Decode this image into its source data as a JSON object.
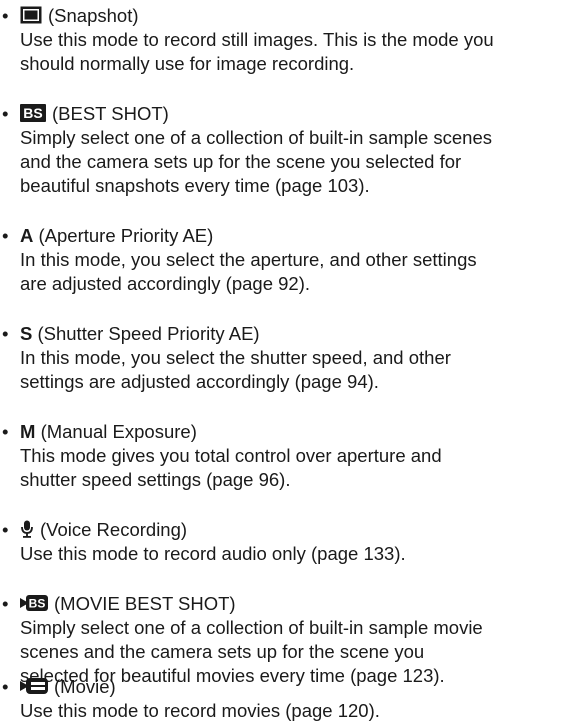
{
  "bullet": "•",
  "entries": [
    {
      "icon": "snapshot-icon",
      "name": "(Snapshot)",
      "lines": [
        "Use this mode to record still images. This is the mode you",
        "should normally use for image recording."
      ]
    },
    {
      "icon": "best-shot-icon",
      "icon_text": "BS",
      "name": "(BEST SHOT)",
      "lines": [
        "Simply select one of a collection of built-in sample scenes",
        "and the camera sets up for the scene you selected for",
        "beautiful snapshots every time (page 103)."
      ]
    },
    {
      "symbol": "A",
      "name": "(Aperture Priority AE)",
      "lines": [
        "In this mode, you select the aperture, and other settings",
        "are adjusted accordingly (page 92)."
      ]
    },
    {
      "symbol": "S",
      "name": "(Shutter Speed Priority AE)",
      "lines": [
        "In this mode, you select the shutter speed, and other",
        "settings are adjusted accordingly (page 94)."
      ]
    },
    {
      "symbol": "M",
      "name": "(Manual Exposure)",
      "lines": [
        "This mode gives you total control over aperture and",
        "shutter speed settings (page 96)."
      ]
    },
    {
      "icon": "microphone-icon",
      "name": "(Voice Recording)",
      "lines": [
        "Use this mode to record audio only (page 133)."
      ]
    },
    {
      "icon": "movie-best-shot-icon",
      "icon_text": "BS",
      "name": "(MOVIE BEST SHOT)",
      "lines": [
        "Simply select one of a collection of built-in sample movie",
        "scenes and the camera sets up for the scene you",
        "selected for beautiful movies every time (page 123)."
      ]
    },
    {
      "icon": "movie-camera-icon",
      "name": "(Movie)",
      "lines": [
        "Use this mode to record movies (page 120)."
      ]
    }
  ]
}
